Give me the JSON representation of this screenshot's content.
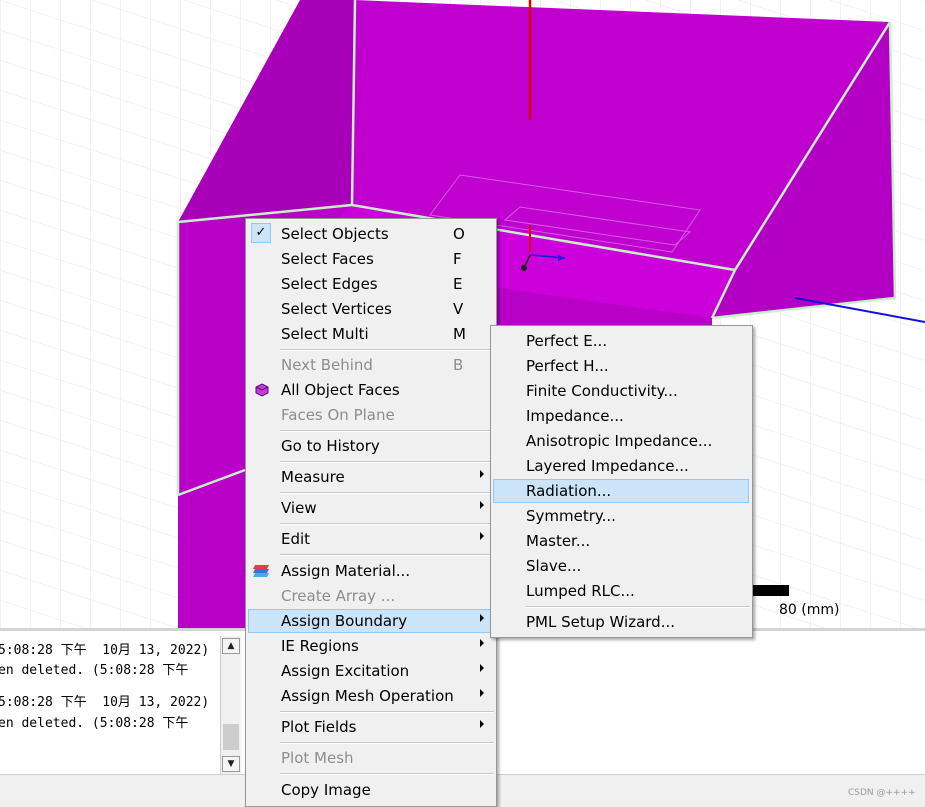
{
  "colors": {
    "object_fill": "#b800c8",
    "object_fill_light": "#d000e0",
    "edge_highlight": "#c8f0c8",
    "menu_bg": "#f0f0f0",
    "highlight_bg": "#cce4f7",
    "highlight_border": "#90c8f6"
  },
  "scale": {
    "label": "80 (mm)"
  },
  "context_menu": {
    "items": [
      {
        "label": "Select Objects",
        "key": "O",
        "checked": true
      },
      {
        "label": "Select Faces",
        "key": "F"
      },
      {
        "label": "Select Edges",
        "key": "E"
      },
      {
        "label": "Select Vertices",
        "key": "V"
      },
      {
        "label": "Select Multi",
        "key": "M"
      },
      {
        "label": "Next Behind",
        "key": "B",
        "disabled": true
      },
      {
        "label": "All Object Faces",
        "icon": "cube-icon"
      },
      {
        "label": "Faces On Plane",
        "disabled": true
      },
      {
        "label": "Go to History"
      },
      {
        "label": "Measure",
        "submenu": true
      },
      {
        "label": "View",
        "submenu": true
      },
      {
        "label": "Edit",
        "submenu": true
      },
      {
        "label": "Assign Material...",
        "icon": "material-icon"
      },
      {
        "label": "Create Array ...",
        "disabled": true
      },
      {
        "label": "Assign Boundary",
        "submenu": true,
        "highlighted": true
      },
      {
        "label": "IE Regions",
        "submenu": true
      },
      {
        "label": "Assign Excitation",
        "submenu": true
      },
      {
        "label": "Assign Mesh Operation",
        "submenu": true
      },
      {
        "label": "Plot Fields",
        "submenu": true
      },
      {
        "label": "Plot Mesh",
        "disabled": true
      },
      {
        "label": "Copy Image"
      }
    ]
  },
  "boundary_submenu": {
    "items": [
      {
        "label": "Perfect E..."
      },
      {
        "label": "Perfect H..."
      },
      {
        "label": "Finite Conductivity..."
      },
      {
        "label": "Impedance..."
      },
      {
        "label": "Anisotropic Impedance..."
      },
      {
        "label": "Layered Impedance..."
      },
      {
        "label": "Radiation...",
        "highlighted": true
      },
      {
        "label": "Symmetry..."
      },
      {
        "label": "Master..."
      },
      {
        "label": "Slave..."
      },
      {
        "label": "Lumped RLC..."
      },
      {
        "label": "PML Setup Wizard..."
      }
    ]
  },
  "log": {
    "lines": [
      "5:08:28 下午  10月 13, 2022)",
      "en deleted. (5:08:28 下午",
      "5:08:28 下午  10月 13, 2022)",
      "en deleted. (5:08:28 下午"
    ]
  },
  "watermark": "CSDN @++++"
}
